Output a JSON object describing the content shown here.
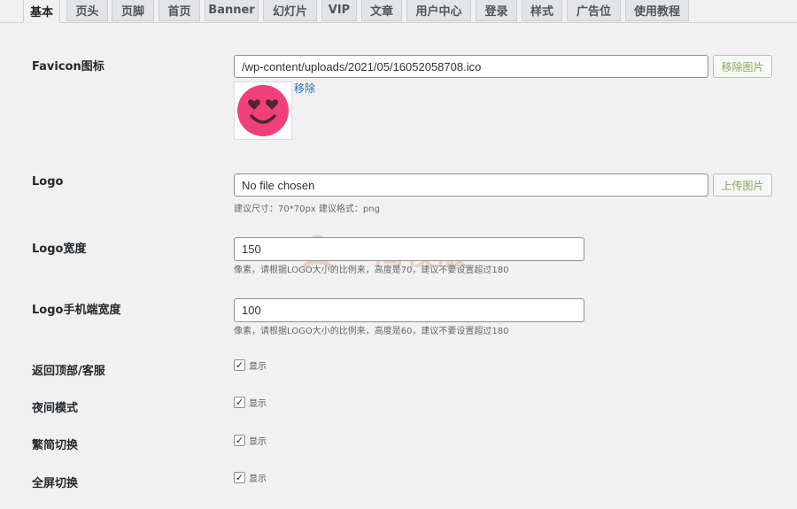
{
  "tabs": [
    "基本",
    "页头",
    "页脚",
    "首页",
    "Banner",
    "幻灯片",
    "VIP",
    "文章",
    "用户中心",
    "登录",
    "样式",
    "广告位",
    "使用教程"
  ],
  "favicon": {
    "label": "Favicon图标",
    "value": "/wp-content/uploads/2021/05/16052058708.ico",
    "button": "移除图片",
    "remove_link": "移除",
    "thumb_icon": "heart-eyes-smiley-icon"
  },
  "logo": {
    "label": "Logo",
    "value": "No file chosen",
    "button": "上传图片",
    "hint": "建议尺寸：70*70px 建议格式：png"
  },
  "logo_width": {
    "label": "Logo宽度",
    "value": "150",
    "hint": "像素，请根据LOGO大小的比例来，高度是70，建议不要设置超过180"
  },
  "logo_mobile_width": {
    "label": "Logo手机端宽度",
    "value": "100",
    "hint": "像素，请根据LOGO大小的比例来，高度是60，建议不要设置超过180"
  },
  "toggles": [
    {
      "label": "返回顶部/客服",
      "option": "显示",
      "checked": true
    },
    {
      "label": "夜间模式",
      "option": "显示",
      "checked": true
    },
    {
      "label": "繁简切换",
      "option": "显示",
      "checked": true
    },
    {
      "label": "全屏切换",
      "option": "显示",
      "checked": true
    }
  ],
  "watermark": "一淘模版",
  "colors": {
    "accent": "#2271b1",
    "button_text": "#8aa85a",
    "watermark": "#e84c20",
    "favicon": "#f0407a"
  }
}
